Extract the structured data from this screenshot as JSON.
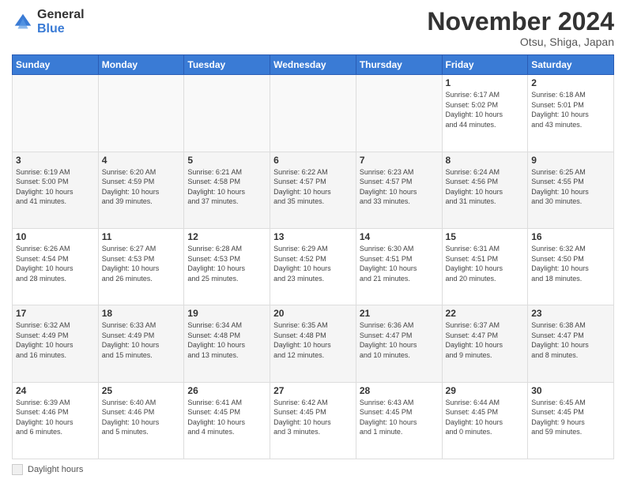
{
  "logo": {
    "general": "General",
    "blue": "Blue"
  },
  "title": "November 2024",
  "subtitle": "Otsu, Shiga, Japan",
  "days_of_week": [
    "Sunday",
    "Monday",
    "Tuesday",
    "Wednesday",
    "Thursday",
    "Friday",
    "Saturday"
  ],
  "footer_legend": "Daylight hours",
  "weeks": [
    [
      {
        "day": "",
        "info": ""
      },
      {
        "day": "",
        "info": ""
      },
      {
        "day": "",
        "info": ""
      },
      {
        "day": "",
        "info": ""
      },
      {
        "day": "",
        "info": ""
      },
      {
        "day": "1",
        "info": "Sunrise: 6:17 AM\nSunset: 5:02 PM\nDaylight: 10 hours\nand 44 minutes."
      },
      {
        "day": "2",
        "info": "Sunrise: 6:18 AM\nSunset: 5:01 PM\nDaylight: 10 hours\nand 43 minutes."
      }
    ],
    [
      {
        "day": "3",
        "info": "Sunrise: 6:19 AM\nSunset: 5:00 PM\nDaylight: 10 hours\nand 41 minutes."
      },
      {
        "day": "4",
        "info": "Sunrise: 6:20 AM\nSunset: 4:59 PM\nDaylight: 10 hours\nand 39 minutes."
      },
      {
        "day": "5",
        "info": "Sunrise: 6:21 AM\nSunset: 4:58 PM\nDaylight: 10 hours\nand 37 minutes."
      },
      {
        "day": "6",
        "info": "Sunrise: 6:22 AM\nSunset: 4:57 PM\nDaylight: 10 hours\nand 35 minutes."
      },
      {
        "day": "7",
        "info": "Sunrise: 6:23 AM\nSunset: 4:57 PM\nDaylight: 10 hours\nand 33 minutes."
      },
      {
        "day": "8",
        "info": "Sunrise: 6:24 AM\nSunset: 4:56 PM\nDaylight: 10 hours\nand 31 minutes."
      },
      {
        "day": "9",
        "info": "Sunrise: 6:25 AM\nSunset: 4:55 PM\nDaylight: 10 hours\nand 30 minutes."
      }
    ],
    [
      {
        "day": "10",
        "info": "Sunrise: 6:26 AM\nSunset: 4:54 PM\nDaylight: 10 hours\nand 28 minutes."
      },
      {
        "day": "11",
        "info": "Sunrise: 6:27 AM\nSunset: 4:53 PM\nDaylight: 10 hours\nand 26 minutes."
      },
      {
        "day": "12",
        "info": "Sunrise: 6:28 AM\nSunset: 4:53 PM\nDaylight: 10 hours\nand 25 minutes."
      },
      {
        "day": "13",
        "info": "Sunrise: 6:29 AM\nSunset: 4:52 PM\nDaylight: 10 hours\nand 23 minutes."
      },
      {
        "day": "14",
        "info": "Sunrise: 6:30 AM\nSunset: 4:51 PM\nDaylight: 10 hours\nand 21 minutes."
      },
      {
        "day": "15",
        "info": "Sunrise: 6:31 AM\nSunset: 4:51 PM\nDaylight: 10 hours\nand 20 minutes."
      },
      {
        "day": "16",
        "info": "Sunrise: 6:32 AM\nSunset: 4:50 PM\nDaylight: 10 hours\nand 18 minutes."
      }
    ],
    [
      {
        "day": "17",
        "info": "Sunrise: 6:32 AM\nSunset: 4:49 PM\nDaylight: 10 hours\nand 16 minutes."
      },
      {
        "day": "18",
        "info": "Sunrise: 6:33 AM\nSunset: 4:49 PM\nDaylight: 10 hours\nand 15 minutes."
      },
      {
        "day": "19",
        "info": "Sunrise: 6:34 AM\nSunset: 4:48 PM\nDaylight: 10 hours\nand 13 minutes."
      },
      {
        "day": "20",
        "info": "Sunrise: 6:35 AM\nSunset: 4:48 PM\nDaylight: 10 hours\nand 12 minutes."
      },
      {
        "day": "21",
        "info": "Sunrise: 6:36 AM\nSunset: 4:47 PM\nDaylight: 10 hours\nand 10 minutes."
      },
      {
        "day": "22",
        "info": "Sunrise: 6:37 AM\nSunset: 4:47 PM\nDaylight: 10 hours\nand 9 minutes."
      },
      {
        "day": "23",
        "info": "Sunrise: 6:38 AM\nSunset: 4:47 PM\nDaylight: 10 hours\nand 8 minutes."
      }
    ],
    [
      {
        "day": "24",
        "info": "Sunrise: 6:39 AM\nSunset: 4:46 PM\nDaylight: 10 hours\nand 6 minutes."
      },
      {
        "day": "25",
        "info": "Sunrise: 6:40 AM\nSunset: 4:46 PM\nDaylight: 10 hours\nand 5 minutes."
      },
      {
        "day": "26",
        "info": "Sunrise: 6:41 AM\nSunset: 4:45 PM\nDaylight: 10 hours\nand 4 minutes."
      },
      {
        "day": "27",
        "info": "Sunrise: 6:42 AM\nSunset: 4:45 PM\nDaylight: 10 hours\nand 3 minutes."
      },
      {
        "day": "28",
        "info": "Sunrise: 6:43 AM\nSunset: 4:45 PM\nDaylight: 10 hours\nand 1 minute."
      },
      {
        "day": "29",
        "info": "Sunrise: 6:44 AM\nSunset: 4:45 PM\nDaylight: 10 hours\nand 0 minutes."
      },
      {
        "day": "30",
        "info": "Sunrise: 6:45 AM\nSunset: 4:45 PM\nDaylight: 9 hours\nand 59 minutes."
      }
    ]
  ]
}
